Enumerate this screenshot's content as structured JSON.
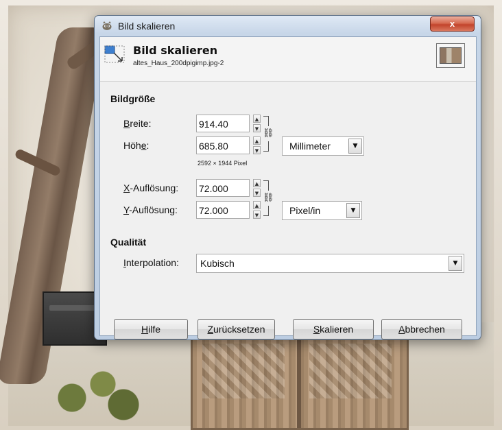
{
  "window": {
    "title": "Bild skalieren",
    "close_glyph": "x",
    "icon": "gimp-wilber-icon"
  },
  "header": {
    "title": "Bild skalieren",
    "subtitle": "altes_Haus_200dpigimp.jpg-2",
    "icon": "scale-image-icon",
    "thumbnail": "image-thumbnail"
  },
  "image_size": {
    "section_label": "Bildgröße",
    "width": {
      "label_pre": "",
      "label_u": "B",
      "label_post": "reite:",
      "value": "914.40"
    },
    "height": {
      "label_pre": "Höh",
      "label_u": "e",
      "label_post": ":",
      "value": "685.80"
    },
    "unit": "Millimeter",
    "pixel_info": "2592 × 1944 Pixel",
    "x_resolution": {
      "label_pre": "",
      "label_u": "X",
      "label_post": "-Auflösung:",
      "value": "72.000"
    },
    "y_resolution": {
      "label_pre": "",
      "label_u": "Y",
      "label_post": "-Auflösung:",
      "value": "72.000"
    },
    "resolution_unit": "Pixel/in"
  },
  "quality": {
    "section_label": "Qualität",
    "interpolation": {
      "label_pre": "",
      "label_u": "I",
      "label_post": "nterpolation:",
      "value": "Kubisch"
    }
  },
  "buttons": {
    "help": {
      "pre": "",
      "u": "H",
      "post": "ilfe"
    },
    "reset": {
      "pre": "",
      "u": "Z",
      "post": "urücksetzen"
    },
    "scale": {
      "pre": "",
      "u": "S",
      "post": "kalieren"
    },
    "cancel": {
      "pre": "",
      "u": "A",
      "post": "bbrechen"
    }
  },
  "colors": {
    "titlebar": "#c7d6e8",
    "close_button": "#c2432b",
    "dialog_bg": "#f0f0f0"
  }
}
